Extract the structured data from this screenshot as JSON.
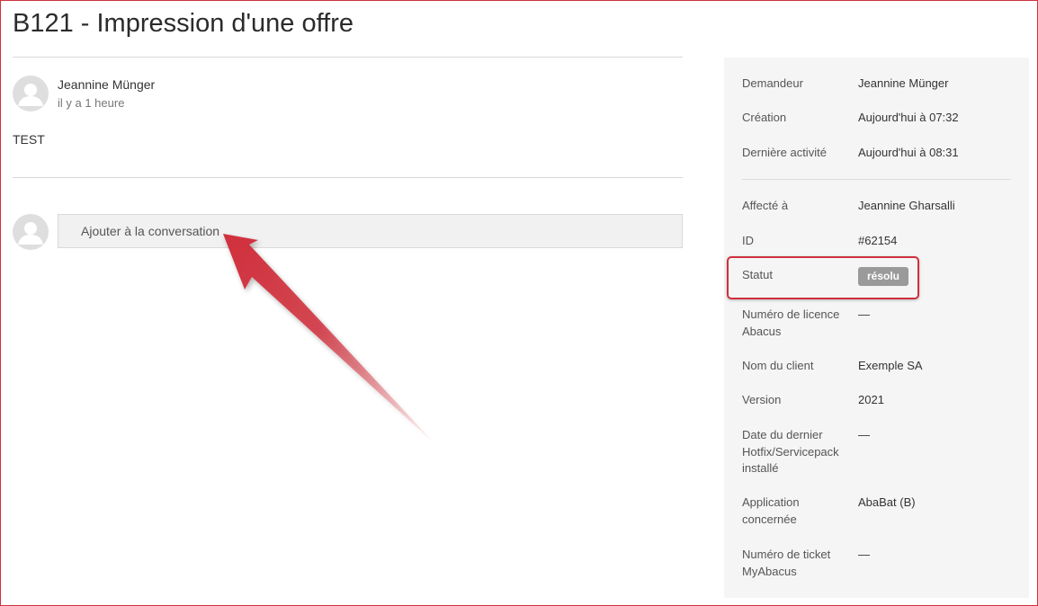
{
  "page": {
    "title": "B121 - Impression d'une offre"
  },
  "comment": {
    "author": "Jeannine Münger",
    "timestamp": "il y a 1 heure",
    "body": "TEST"
  },
  "reply": {
    "placeholder": "Ajouter à la conversation"
  },
  "sidebar": {
    "requester": {
      "label": "Demandeur",
      "value": "Jeannine Münger"
    },
    "created": {
      "label": "Création",
      "value": "Aujourd'hui à 07:32"
    },
    "last_activity": {
      "label": "Dernière activité",
      "value": "Aujourd'hui à 08:31"
    },
    "assignee": {
      "label": "Affecté à",
      "value": "Jeannine Gharsalli"
    },
    "id": {
      "label": "ID",
      "value": "#62154"
    },
    "status": {
      "label": "Statut",
      "value": "résolu"
    },
    "license": {
      "label": "Numéro de licence Abacus",
      "value": "—"
    },
    "client": {
      "label": "Nom du client",
      "value": "Exemple SA"
    },
    "version": {
      "label": "Version",
      "value": "2021"
    },
    "hotfix": {
      "label": "Date du dernier Hotfix/Servicepack installé",
      "value": "—"
    },
    "application": {
      "label": "Application concernée",
      "value": "AbaBat (B)"
    },
    "myabacus": {
      "label": "Numéro de ticket MyAbacus",
      "value": "—"
    }
  },
  "colors": {
    "highlight": "#d0303c",
    "status_badge": "#9a9a9a",
    "sidebar_bg": "#f5f5f5"
  },
  "icons": {
    "avatar": "user-silhouette-icon",
    "annotation": "red-arrow-annotation"
  }
}
